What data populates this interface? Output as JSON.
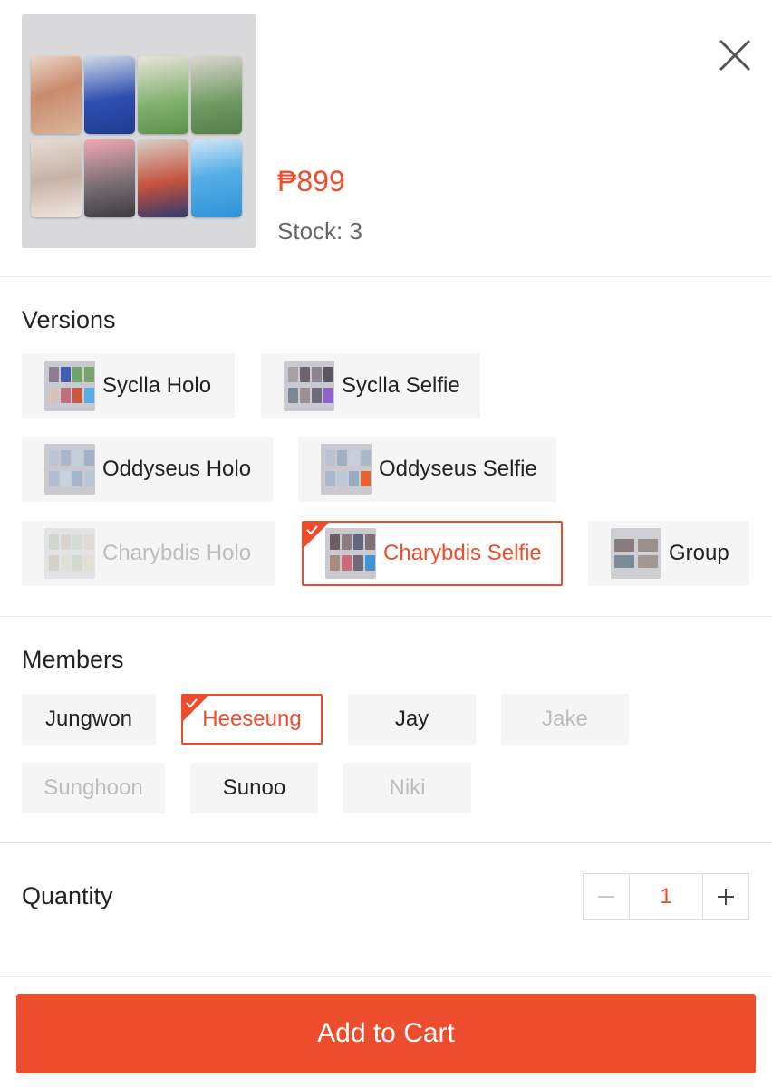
{
  "product": {
    "price": "₱899",
    "stock": "Stock: 3"
  },
  "variations": {
    "title": "Versions",
    "options": [
      {
        "label": "Syclla Holo",
        "state": "available"
      },
      {
        "label": "Syclla Selfie",
        "state": "available"
      },
      {
        "label": "Oddyseus Holo",
        "state": "available"
      },
      {
        "label": "Oddyseus Selfie",
        "state": "available"
      },
      {
        "label": "Charybdis Holo",
        "state": "disabled"
      },
      {
        "label": "Charybdis Selfie",
        "state": "selected"
      },
      {
        "label": "Group",
        "state": "available"
      }
    ]
  },
  "members": {
    "title": "Members",
    "options": [
      {
        "label": "Jungwon",
        "state": "available"
      },
      {
        "label": "Heeseung",
        "state": "selected"
      },
      {
        "label": "Jay",
        "state": "available"
      },
      {
        "label": "Jake",
        "state": "disabled"
      },
      {
        "label": "Sunghoon",
        "state": "disabled"
      },
      {
        "label": "Sunoo",
        "state": "available"
      },
      {
        "label": "Niki",
        "state": "disabled"
      }
    ]
  },
  "quantity": {
    "label": "Quantity",
    "value": "1"
  },
  "cart": {
    "button_label": "Add to Cart"
  },
  "colors": {
    "accent": "#ee4d2d",
    "chip_bg": "#f5f5f5",
    "disabled_text": "#bdbdbd"
  },
  "icons": {
    "close": "close-icon",
    "minus": "minus-icon",
    "plus": "plus-icon",
    "check": "check-icon"
  }
}
